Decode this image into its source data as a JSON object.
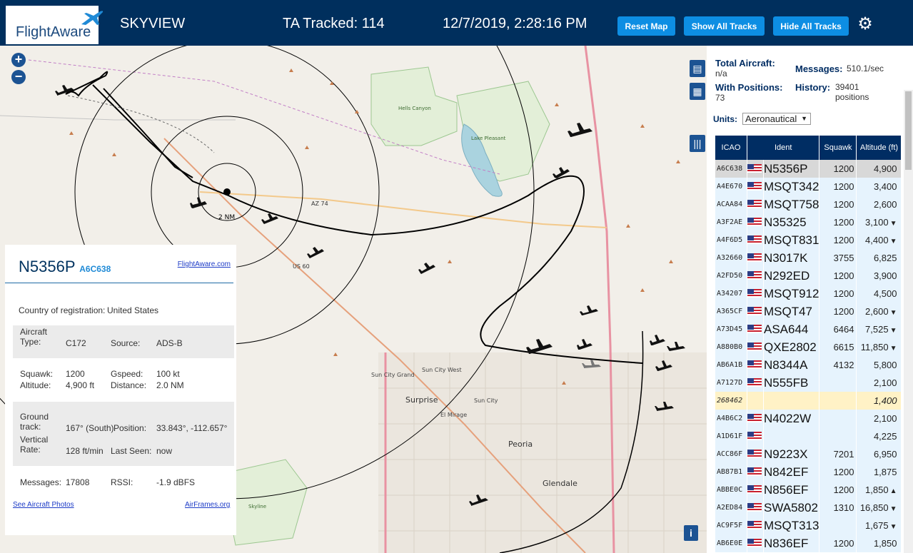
{
  "header": {
    "brand": "FlightAware",
    "site_name": "SKYVIEW",
    "tracked": "TA Tracked: 114",
    "datetime": "12/7/2019, 2:28:16 PM",
    "reset_label": "Reset Map",
    "show_label": "Show All Tracks",
    "hide_label": "Hide All Tracks"
  },
  "map": {
    "range_label": "2 NM",
    "places": [
      "Hells Canyon Wilderness Area",
      "Lake Pleasant Regional Park",
      "Sun City Grand",
      "Sun City West",
      "Surprise",
      "Sun City",
      "El Mirage",
      "Peoria",
      "Glendale",
      "Skyline Regional Park"
    ],
    "roads": [
      "AZ 74",
      "US 60"
    ],
    "copyright": "i"
  },
  "selected": {
    "registration": "N5356P",
    "icao": "A6C638",
    "flightaware_link": "FlightAware.com",
    "country_label": "Country of registration:",
    "country": "United States",
    "aircraft_type_label": "Aircraft Type:",
    "aircraft_type": "C172",
    "source_label": "Source:",
    "source": "ADS-B",
    "squawk_label": "Squawk:",
    "squawk": "1200",
    "gspeed_label": "Gspeed:",
    "gspeed": "100 kt",
    "altitude_label": "Altitude:",
    "altitude": "4,900 ft",
    "distance_label": "Distance:",
    "distance": "2.0 NM",
    "track_label": "Ground track:",
    "track": "167° (South)",
    "position_label": "Position:",
    "position": "33.843°, -112.657°",
    "vrate_label": "Vertical Rate:",
    "vrate": "128 ft/min",
    "lastseen_label": "Last Seen:",
    "lastseen": "now",
    "messages_label": "Messages:",
    "messages": "17808",
    "rssi_label": "RSSI:",
    "rssi": "-1.9 dBFS",
    "photos_link": "See Aircraft Photos",
    "airframes_link": "AirFrames.org"
  },
  "stats": {
    "total_label": "Total Aircraft:",
    "total": "n/a",
    "positions_label": "With Positions:",
    "positions": "73",
    "messages_label": "Messages:",
    "messages": "510.1/sec",
    "history_label": "History:",
    "history": "39401 positions",
    "units_label": "Units:",
    "units": "Aeronautical"
  },
  "table": {
    "columns": [
      "ICAO",
      "Ident",
      "Squawk",
      "Altitude (ft)"
    ],
    "rows": [
      {
        "icao": "A6C638",
        "flag": true,
        "ident": "N5356P",
        "squawk": "1200",
        "alt": "4,900",
        "trend": ""
      },
      {
        "icao": "A4E670",
        "flag": true,
        "ident": "MSQT342",
        "squawk": "1200",
        "alt": "3,400",
        "trend": ""
      },
      {
        "icao": "ACAA84",
        "flag": true,
        "ident": "MSQT758",
        "squawk": "1200",
        "alt": "2,600",
        "trend": ""
      },
      {
        "icao": "A3F2AE",
        "flag": true,
        "ident": "N35325",
        "squawk": "1200",
        "alt": "3,100",
        "trend": "▼"
      },
      {
        "icao": "A4F6D5",
        "flag": true,
        "ident": "MSQT831",
        "squawk": "1200",
        "alt": "4,400",
        "trend": "▼"
      },
      {
        "icao": "A32660",
        "flag": true,
        "ident": "N3017K",
        "squawk": "3755",
        "alt": "6,825",
        "trend": ""
      },
      {
        "icao": "A2FD50",
        "flag": true,
        "ident": "N292ED",
        "squawk": "1200",
        "alt": "3,900",
        "trend": ""
      },
      {
        "icao": "A34207",
        "flag": true,
        "ident": "MSQT912",
        "squawk": "1200",
        "alt": "4,500",
        "trend": ""
      },
      {
        "icao": "A365CF",
        "flag": true,
        "ident": "MSQT47",
        "squawk": "1200",
        "alt": "2,600",
        "trend": "▼"
      },
      {
        "icao": "A73D45",
        "flag": true,
        "ident": "ASA644",
        "squawk": "6464",
        "alt": "7,525",
        "trend": "▼"
      },
      {
        "icao": "A880B0",
        "flag": true,
        "ident": "QXE2802",
        "squawk": "6615",
        "alt": "11,850",
        "trend": "▼"
      },
      {
        "icao": "AB6A1B",
        "flag": true,
        "ident": "N8344A",
        "squawk": "4132",
        "alt": "5,800",
        "trend": ""
      },
      {
        "icao": "A7127D",
        "flag": true,
        "ident": "N555FB",
        "squawk": "",
        "alt": "2,100",
        "trend": ""
      },
      {
        "icao": "268462",
        "flag": false,
        "ident": "",
        "squawk": "",
        "alt": "1,400",
        "trend": ""
      },
      {
        "icao": "A4B6C2",
        "flag": true,
        "ident": "N4022W",
        "squawk": "",
        "alt": "2,100",
        "trend": ""
      },
      {
        "icao": "A1D61F",
        "flag": true,
        "ident": "",
        "squawk": "",
        "alt": "4,225",
        "trend": ""
      },
      {
        "icao": "ACC86F",
        "flag": true,
        "ident": "N9223X",
        "squawk": "7201",
        "alt": "6,950",
        "trend": ""
      },
      {
        "icao": "AB87B1",
        "flag": true,
        "ident": "N842EF",
        "squawk": "1200",
        "alt": "1,875",
        "trend": ""
      },
      {
        "icao": "ABBE0C",
        "flag": true,
        "ident": "N856EF",
        "squawk": "1200",
        "alt": "1,850",
        "trend": "▲"
      },
      {
        "icao": "A2ED84",
        "flag": true,
        "ident": "SWA5802",
        "squawk": "1310",
        "alt": "16,850",
        "trend": "▼"
      },
      {
        "icao": "AC9F5F",
        "flag": true,
        "ident": "MSQT313",
        "squawk": "",
        "alt": "1,675",
        "trend": "▼"
      },
      {
        "icao": "AB6E0E",
        "flag": true,
        "ident": "N836EF",
        "squawk": "1200",
        "alt": "1,850",
        "trend": ""
      }
    ]
  },
  "colors": {
    "header_bg": "#002f5d",
    "button": "#0d8ee3",
    "row": "#e6f3fd",
    "selected_row": "#d8d8d8",
    "mlat_row": "#fff2c6"
  }
}
